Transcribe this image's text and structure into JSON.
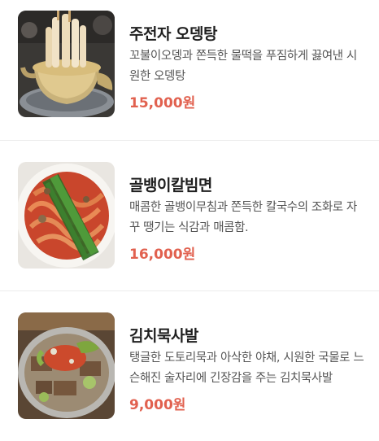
{
  "menu": {
    "items": [
      {
        "image_icon": "odeng-soup-photo",
        "title": "주전자 오뎅탕",
        "description": "꼬불이오뎅과 쫀득한 물떡을 푸짐하게 끓여낸 시원한 오뎅탕",
        "price": "15,000원"
      },
      {
        "image_icon": "whelk-noodle-photo",
        "title": "골뱅이칼빔면",
        "description": "매콤한 골뱅이무침과 쫀득한 칼국수의 조화로 자꾸 땡기는 식감과 매콤함.",
        "price": "16,000원"
      },
      {
        "image_icon": "acorn-jelly-bowl-photo",
        "title": "김치묵사발",
        "description": "탱글한 도토리묵과 아삭한 야채, 시원한 국물로 느슨해진 술자리에 긴장감을 주는 김치묵사발",
        "price": "9,000원"
      }
    ]
  },
  "colors": {
    "price": "#e1614f",
    "divider": "#ececec"
  }
}
